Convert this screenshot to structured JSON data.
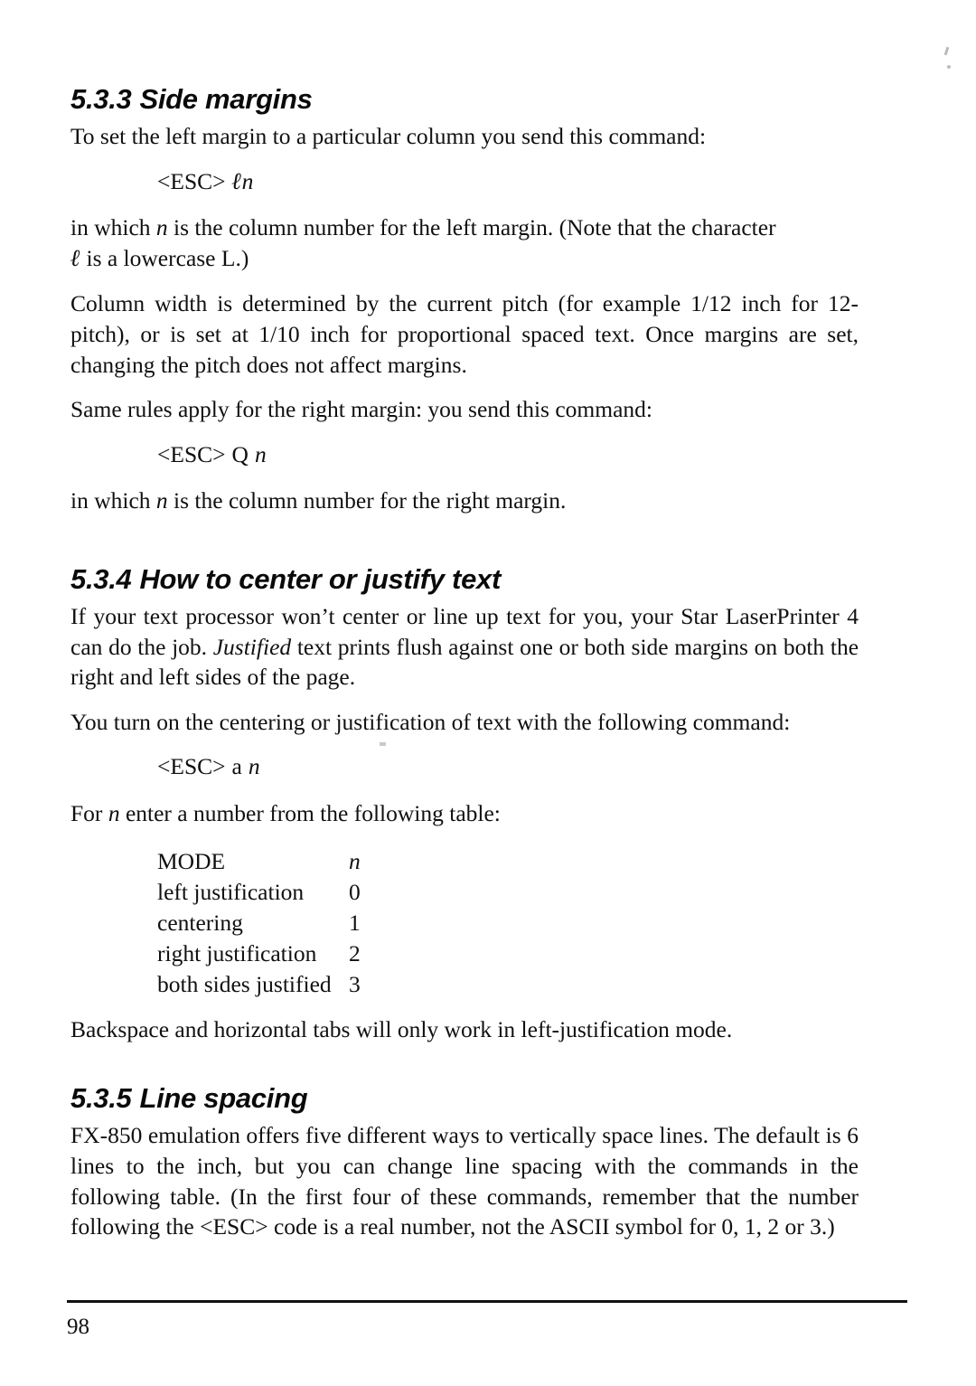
{
  "page": {
    "number": "98"
  },
  "sections": [
    {
      "number": "5.3.3",
      "title": "Side margins",
      "intro": "To set the left margin to a particular column you send this command:",
      "command1_prefix": "<ESC>",
      "command1_slash": "ℓ",
      "command1_n": "n",
      "para1_a": "in which ",
      "para1_n": "n",
      "para1_b": " is the column number for the left margin. (Note that the character",
      "para1_c": " is a lowercase L.)",
      "para2": "Column width is determined by the current pitch (for example 1/12 inch for 12-pitch), or is set at 1/10 inch for proportional spaced text. Once margins are set, changing the pitch does not affect margins.",
      "para3": "Same rules apply for the right margin: you send this command:",
      "command2_prefix": "<ESC>",
      "command2_letter": "Q",
      "command2_n": "n",
      "para4_a": "in which ",
      "para4_n": "n",
      "para4_b": " is the column number for the right margin."
    },
    {
      "number": "5.3.4",
      "title": "How to center or justify text",
      "para1_a": "If your text processor won’t center or line up text for you, your Star LaserPrinter 4  can do the job. ",
      "para1_italic": "Justified",
      "para1_b": " text prints flush against one or both side margins on both the right and left sides of the page.",
      "para2": "You turn on the centering or justification of text with the following command:",
      "command_prefix": "<ESC>",
      "command_letter": "a",
      "command_n": "n",
      "para3_a": "For ",
      "para3_n": "n",
      "para3_b": " enter a number from the following table:",
      "table": {
        "headers": [
          "MODE",
          "n"
        ],
        "rows": [
          [
            "left justification",
            "0"
          ],
          [
            "centering",
            "1"
          ],
          [
            "right justification",
            "2"
          ],
          [
            "both sides justified",
            "3"
          ]
        ]
      },
      "para4": "Backspace and horizontal tabs will only work in left-justification mode."
    },
    {
      "number": "5.3.5",
      "title": "Line spacing",
      "para1": "FX-850 emulation offers five different ways to vertically space lines. The default is 6 lines to the inch, but you can change line spacing with the commands in the following table. (In the first four of these commands, remember that the number following the <ESC> code is a real number, not the ASCII symbol for 0, 1, 2 or 3.)"
    }
  ]
}
